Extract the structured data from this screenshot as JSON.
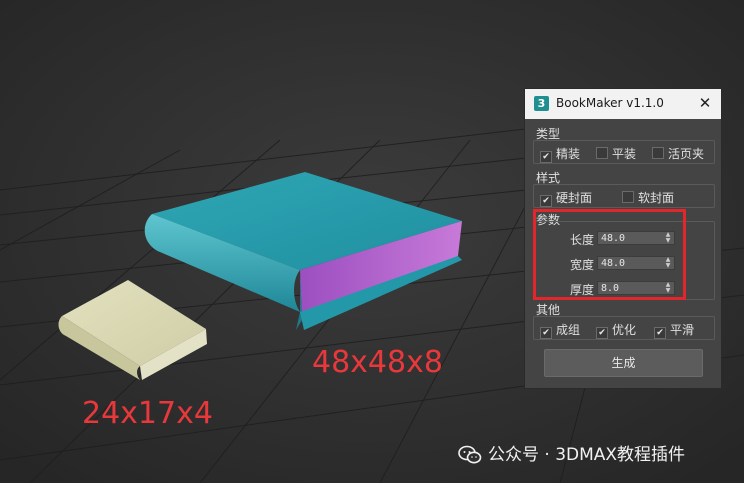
{
  "viewport": {
    "large_book_label": "48x48x8",
    "small_book_label": "24x17x4",
    "label_color": "#e8383b",
    "background": "#2f2f2f"
  },
  "dialog": {
    "title": "BookMaker v1.1.0",
    "icon_glyph": "3",
    "close_glyph": "✕",
    "groups": {
      "type": {
        "label": "类型",
        "options": [
          {
            "label": "精装",
            "checked": true
          },
          {
            "label": "平装",
            "checked": false
          },
          {
            "label": "活页夹",
            "checked": false
          }
        ]
      },
      "style": {
        "label": "样式",
        "options": [
          {
            "label": "硬封面",
            "checked": true
          },
          {
            "label": "软封面",
            "checked": false
          }
        ]
      },
      "params": {
        "label": "参数",
        "fields": [
          {
            "label": "长度",
            "value": "48.0"
          },
          {
            "label": "宽度",
            "value": "48.0"
          },
          {
            "label": "厚度",
            "value": "8.0"
          }
        ]
      },
      "other": {
        "label": "其他",
        "options": [
          {
            "label": "成组",
            "checked": true
          },
          {
            "label": "优化",
            "checked": true
          },
          {
            "label": "平滑",
            "checked": true
          }
        ]
      }
    },
    "generate_label": "生成"
  },
  "watermark": {
    "text": "公众号 · 3DMAX教程插件"
  },
  "colors": {
    "highlight": "#e3262b",
    "book_cover": "#2aa0b0",
    "book_pages": "#b05fc8",
    "small_book": "#d9d8b4"
  }
}
